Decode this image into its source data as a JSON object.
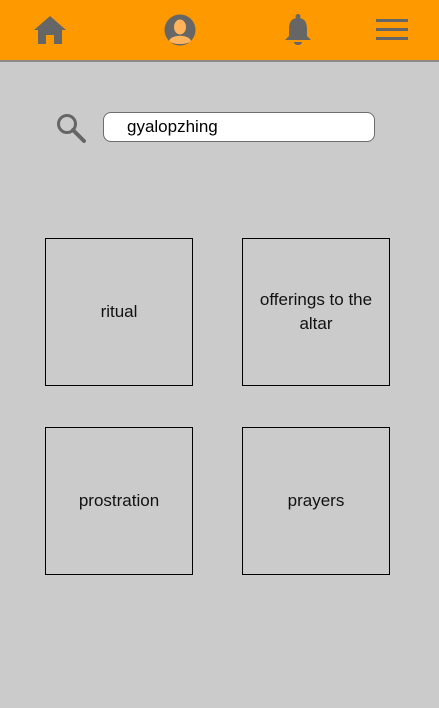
{
  "nav": {
    "icons": [
      "home-icon",
      "profile-icon",
      "notification-bell-icon",
      "menu-icon"
    ],
    "bar_color": "#ff9900",
    "icon_color": "#666666"
  },
  "search": {
    "icon": "search-icon",
    "value": "gyalopzhing"
  },
  "tiles": [
    {
      "label": "ritual"
    },
    {
      "label": "offerings to the altar"
    },
    {
      "label": "prostration"
    },
    {
      "label": "prayers"
    }
  ]
}
